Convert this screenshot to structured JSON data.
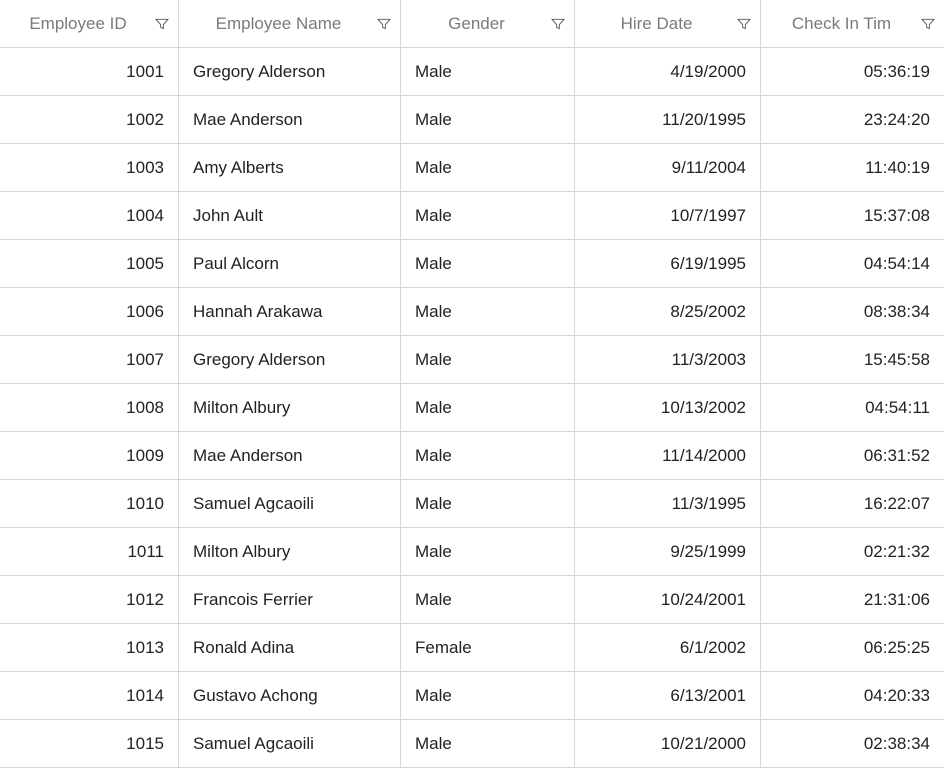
{
  "columns": [
    {
      "label": "Employee ID",
      "align": "right"
    },
    {
      "label": "Employee Name",
      "align": "left"
    },
    {
      "label": "Gender",
      "align": "left"
    },
    {
      "label": "Hire Date",
      "align": "right"
    },
    {
      "label": "Check In Tim",
      "align": "right"
    }
  ],
  "rows": [
    {
      "id": "1001",
      "name": "Gregory Alderson",
      "gender": "Male",
      "hire": "4/19/2000",
      "checkin": "05:36:19"
    },
    {
      "id": "1002",
      "name": "Mae Anderson",
      "gender": "Male",
      "hire": "11/20/1995",
      "checkin": "23:24:20"
    },
    {
      "id": "1003",
      "name": "Amy Alberts",
      "gender": "Male",
      "hire": "9/11/2004",
      "checkin": "11:40:19"
    },
    {
      "id": "1004",
      "name": "John Ault",
      "gender": "Male",
      "hire": "10/7/1997",
      "checkin": "15:37:08"
    },
    {
      "id": "1005",
      "name": "Paul Alcorn",
      "gender": "Male",
      "hire": "6/19/1995",
      "checkin": "04:54:14"
    },
    {
      "id": "1006",
      "name": "Hannah Arakawa",
      "gender": "Male",
      "hire": "8/25/2002",
      "checkin": "08:38:34"
    },
    {
      "id": "1007",
      "name": "Gregory Alderson",
      "gender": "Male",
      "hire": "11/3/2003",
      "checkin": "15:45:58"
    },
    {
      "id": "1008",
      "name": "Milton Albury",
      "gender": "Male",
      "hire": "10/13/2002",
      "checkin": "04:54:11"
    },
    {
      "id": "1009",
      "name": "Mae Anderson",
      "gender": "Male",
      "hire": "11/14/2000",
      "checkin": "06:31:52"
    },
    {
      "id": "1010",
      "name": "Samuel Agcaoili",
      "gender": "Male",
      "hire": "11/3/1995",
      "checkin": "16:22:07"
    },
    {
      "id": "1011",
      "name": "Milton Albury",
      "gender": "Male",
      "hire": "9/25/1999",
      "checkin": "02:21:32"
    },
    {
      "id": "1012",
      "name": "Francois Ferrier",
      "gender": "Male",
      "hire": "10/24/2001",
      "checkin": "21:31:06"
    },
    {
      "id": "1013",
      "name": "Ronald Adina",
      "gender": "Female",
      "hire": "6/1/2002",
      "checkin": "06:25:25"
    },
    {
      "id": "1014",
      "name": "Gustavo Achong",
      "gender": "Male",
      "hire": "6/13/2001",
      "checkin": "04:20:33"
    },
    {
      "id": "1015",
      "name": "Samuel Agcaoili",
      "gender": "Male",
      "hire": "10/21/2000",
      "checkin": "02:38:34"
    }
  ]
}
